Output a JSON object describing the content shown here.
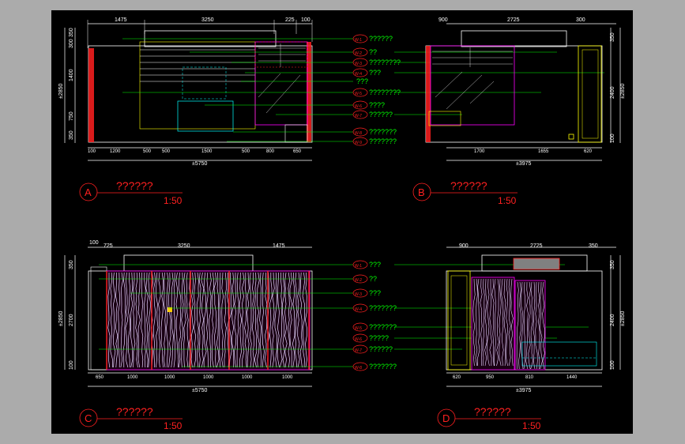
{
  "colors": {
    "background": "#000000",
    "dim": "#ffffff",
    "leader": "#00ff00",
    "title": "#ff0000",
    "wall": "#ff00ff",
    "frame": "#ffff00",
    "aux": "#00ffff"
  },
  "leader_text": "???????",
  "views": [
    {
      "id": "A",
      "title": "??????",
      "scale": "1:50",
      "top_dims": [
        "1475",
        "3250",
        "225",
        "100"
      ],
      "bottom_dims": [
        "100",
        "1200",
        "500",
        "500",
        "1500",
        "500",
        "800",
        "650"
      ],
      "total": "±5750",
      "left_dims": [
        "350",
        "300",
        "1400",
        "750",
        "350"
      ],
      "height_total": "±2850",
      "tags": [
        "??????",
        "??",
        "????????",
        "???",
        "???",
        "????????",
        "????",
        "??????",
        "???????",
        "???????"
      ]
    },
    {
      "id": "B",
      "title": "??????",
      "scale": "1:50",
      "top_dims": [
        "900",
        "2725",
        "300"
      ],
      "bottom_dims": [
        "1700",
        "1655",
        "620"
      ],
      "total": "±3975",
      "right_dims": [
        "350",
        "2400",
        "100"
      ],
      "height_total": "±2850",
      "tags": []
    },
    {
      "id": "C",
      "title": "??????",
      "scale": "1:50",
      "top_dims": [
        "100",
        "725",
        "3250",
        "1475"
      ],
      "bottom_dims": [
        "650",
        "1000",
        "1000",
        "1000",
        "1000",
        "1000"
      ],
      "total": "±5750",
      "left_dims": [
        "350",
        "2700",
        "100"
      ],
      "height_total": "±2850",
      "tags": [
        "???",
        "??",
        "???",
        "???????",
        "???????",
        "?????",
        "??????",
        "???????"
      ]
    },
    {
      "id": "D",
      "title": "??????",
      "scale": "1:50",
      "top_dims": [
        "900",
        "2725",
        "350"
      ],
      "bottom_dims": [
        "620",
        "950",
        "810",
        "1440"
      ],
      "total": "±3975",
      "right_dims": [
        "350",
        "2400",
        "100"
      ],
      "height_total": "±2850",
      "tags": []
    }
  ]
}
